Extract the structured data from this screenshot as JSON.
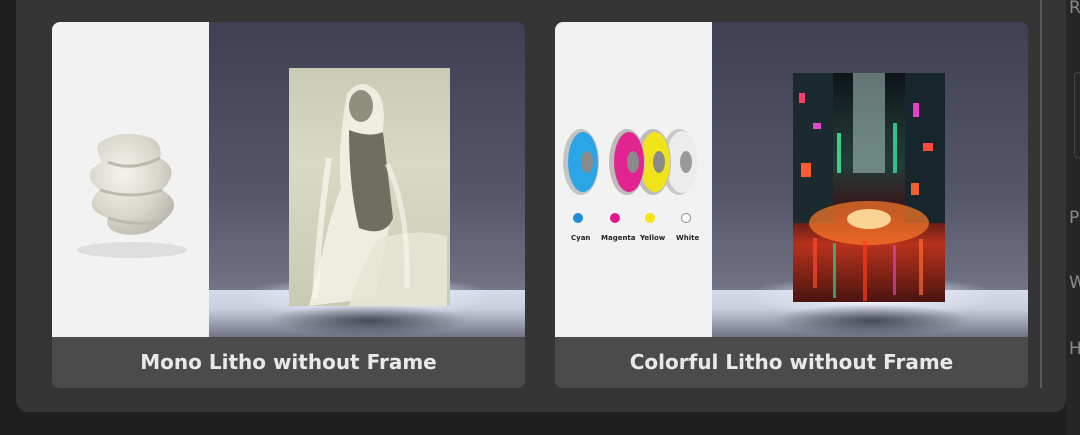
{
  "cards": [
    {
      "label": "Mono Litho without Frame"
    },
    {
      "label": "Colorful Litho without Frame"
    }
  ],
  "filaments": [
    {
      "name": "Cyan",
      "color": "#1e8fd6"
    },
    {
      "name": "Magenta",
      "color": "#e0178d"
    },
    {
      "name": "Yellow",
      "color": "#f3e512"
    },
    {
      "name": "White",
      "color": "#ffffff"
    }
  ],
  "side_panel": {
    "letters": [
      "R",
      "P",
      "W",
      "H"
    ]
  },
  "colors": {
    "dialog_bg": "#353535",
    "label_bg": "#4b4b4b",
    "label_text": "#e9e9e9"
  }
}
